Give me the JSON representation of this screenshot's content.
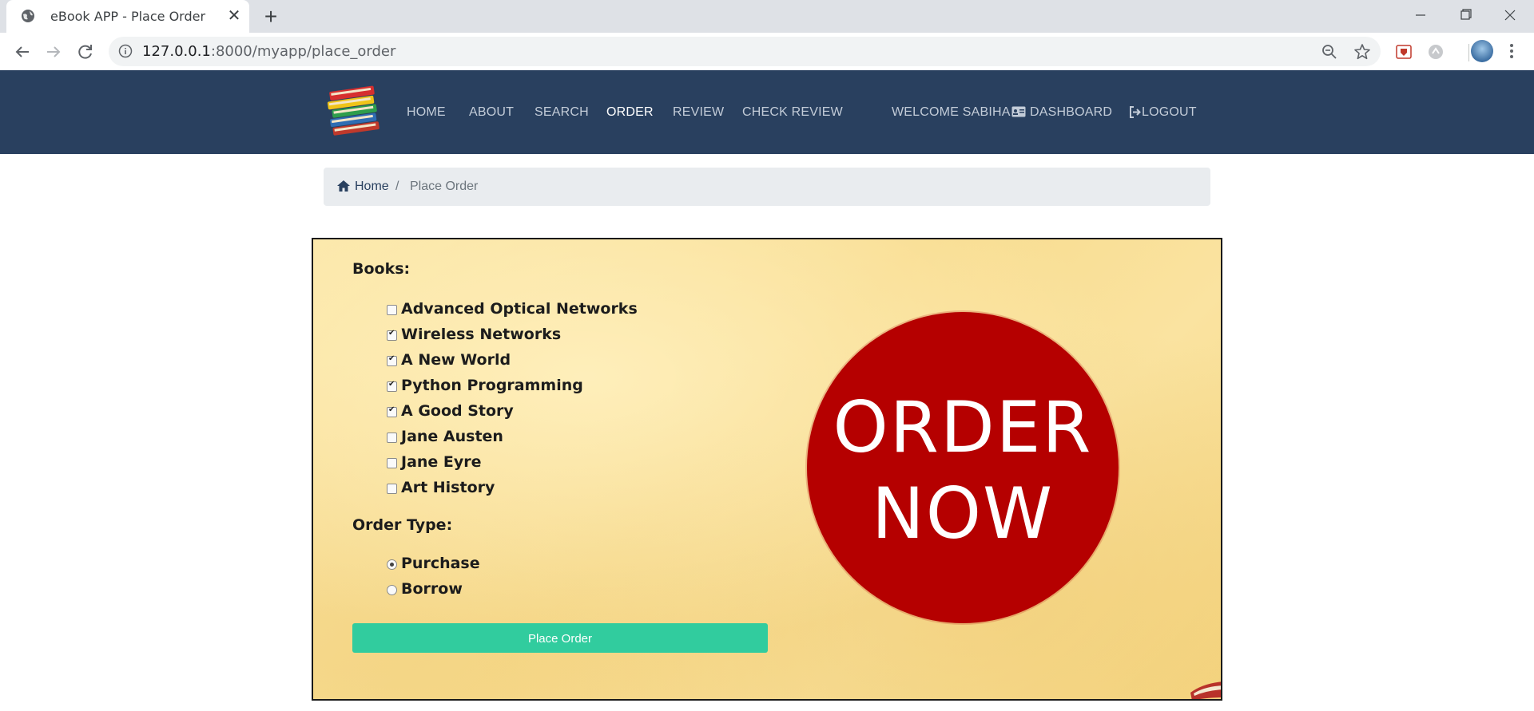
{
  "browser": {
    "tab_title": "eBook APP - Place Order",
    "url_host": "127.0.0.1",
    "url_path": ":8000/myapp/place_order"
  },
  "navbar": {
    "links": [
      {
        "label": "HOME"
      },
      {
        "label": "ABOUT"
      },
      {
        "label": "SEARCH"
      },
      {
        "label": "ORDER",
        "active": true
      },
      {
        "label": "REVIEW"
      },
      {
        "label": "CHECK REVIEW"
      }
    ],
    "welcome": "WELCOME SABIHA",
    "dashboard": "DASHBOARD",
    "logout": "LOGOUT"
  },
  "breadcrumb": {
    "home": "Home",
    "separator": "/",
    "current": "Place Order"
  },
  "form": {
    "books_label": "Books:",
    "books": [
      {
        "title": "Advanced Optical Networks",
        "checked": false
      },
      {
        "title": "Wireless Networks",
        "checked": true
      },
      {
        "title": "A New World",
        "checked": true
      },
      {
        "title": "Python Programming",
        "checked": true
      },
      {
        "title": "A Good Story",
        "checked": true
      },
      {
        "title": "Jane Austen",
        "checked": false
      },
      {
        "title": "Jane Eyre",
        "checked": false
      },
      {
        "title": "Art History",
        "checked": false
      }
    ],
    "order_type_label": "Order Type:",
    "order_types": [
      {
        "label": "Purchase",
        "selected": true
      },
      {
        "label": "Borrow",
        "selected": false
      }
    ],
    "submit_label": "Place Order"
  },
  "badge": {
    "line1": "ORDER",
    "line2": "NOW"
  },
  "colors": {
    "navbar": "#29405f",
    "submit": "#31cc9e",
    "badge": "#b50000"
  }
}
